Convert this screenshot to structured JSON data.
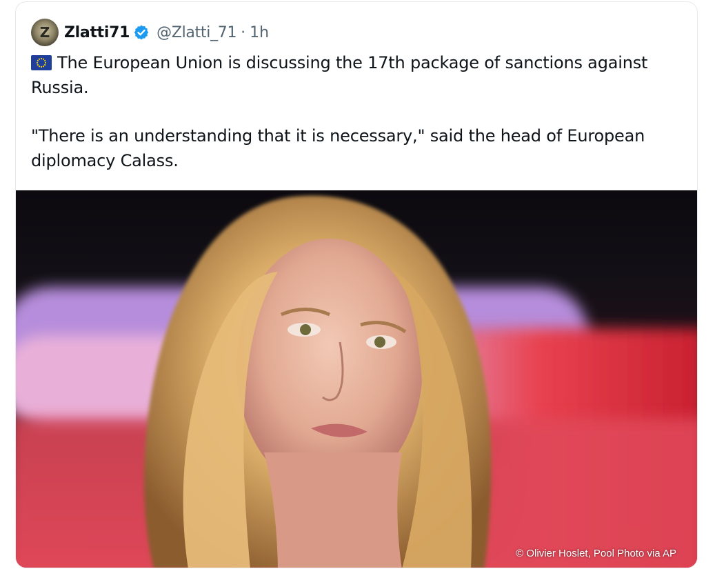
{
  "post": {
    "author_name": "Zlatti71",
    "handle": "@Zlatti_71",
    "separator": "·",
    "time": "1h",
    "flag_icon": "eu-flag-icon",
    "paragraph1": "The European Union is discussing the 17th package of sanctions against Russia.",
    "paragraph2": "\"There is an understanding that it is necessary,\" said the head of European diplomacy Calass.",
    "verified_color": "#1d9bf0"
  },
  "media": {
    "credit": "© Olivier Hoslet, Pool Photo via AP"
  }
}
